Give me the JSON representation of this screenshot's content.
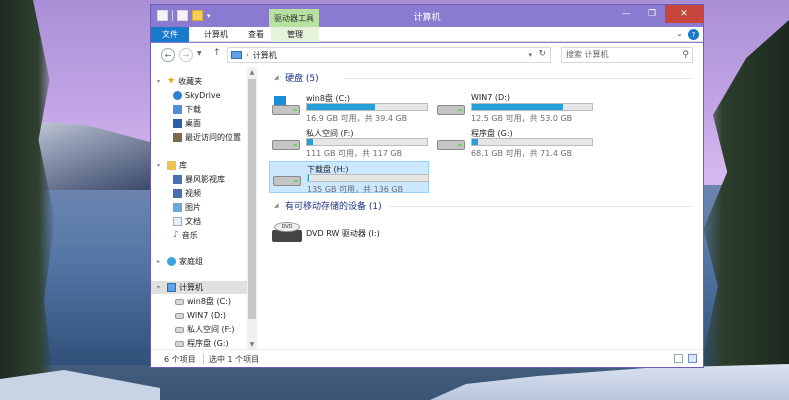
{
  "window": {
    "title": "计算机",
    "context_tab": "驱动器工具",
    "min": "—",
    "max": "❐",
    "close": "✕"
  },
  "ribbon": {
    "tabs": [
      "文件",
      "计算机",
      "查看",
      "管理"
    ],
    "help": "?"
  },
  "address": {
    "path": "计算机",
    "search_placeholder": "搜索 计算机"
  },
  "nav": {
    "favorites": "收藏夹",
    "skydrive": "SkyDrive",
    "downloads": "下载",
    "desktop": "桌面",
    "recent": "最近访问的位置",
    "libraries": "库",
    "storm": "暴风影视库",
    "videos": "视频",
    "pictures": "图片",
    "documents": "文档",
    "music": "音乐",
    "homegroup": "家庭组",
    "computer": "计算机",
    "drives": [
      "win8盘 (C:)",
      "WIN7 (D:)",
      "私人空间 (F:)",
      "程序盘 (G:)"
    ]
  },
  "content": {
    "hdd_header": "硬盘 (5)",
    "removable_header": "有可移动存储的设备 (1)",
    "drives": [
      {
        "name": "win8盘 (C:)",
        "free": "16.9 GB 可用，共 39.4 GB",
        "used_fraction": 0.57
      },
      {
        "name": "WIN7 (D:)",
        "free": "12.5 GB 可用，共 53.0 GB",
        "used_fraction": 0.76
      },
      {
        "name": "私人空间 (F:)",
        "free": "111 GB 可用，共 117 GB",
        "used_fraction": 0.05
      },
      {
        "name": "程序盘 (G:)",
        "free": "68.1 GB 可用，共 71.4 GB",
        "used_fraction": 0.05
      },
      {
        "name": "下载盘 (H:)",
        "free": "135 GB 可用，共 136 GB",
        "used_fraction": 0.01
      }
    ],
    "dvd": {
      "name": "DVD RW 驱动器 (I:)",
      "label": "DVD"
    }
  },
  "status": {
    "count": "6 个项目",
    "selected": "选中 1 个项目"
  }
}
